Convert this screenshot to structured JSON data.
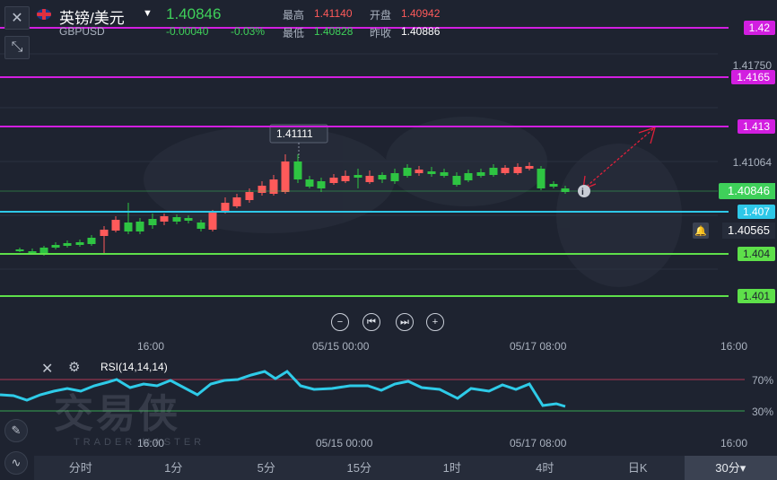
{
  "header": {
    "symbol": "英镑/美元",
    "code": "GBPUSD",
    "last_price": "1.40846",
    "change": "-0.00040",
    "change_pct": "-0.03%",
    "high_label": "最高",
    "high_value": "1.41140",
    "open_label": "开盘",
    "open_value": "1.40942",
    "low_label": "最低",
    "low_value": "1.40828",
    "prev_close_label": "昨收",
    "prev_close_value": "1.40886"
  },
  "levels": [
    {
      "label": "1.42",
      "color": "#d21ee0"
    },
    {
      "label": "1.4165",
      "color": "#d21ee0"
    },
    {
      "label": "1.413",
      "color": "#d21ee0"
    },
    {
      "label": "1.407",
      "color": "#2ec8e8"
    },
    {
      "label": "1.404",
      "color": "#5ee04a"
    },
    {
      "label": "1.401",
      "color": "#5ee04a"
    }
  ],
  "axis_prices": {
    "p1": "1.41750",
    "p2": "1.41064",
    "current": "1.40846",
    "alert": "1.40565"
  },
  "peak_label": "1.41111",
  "price_time_labels": [
    "16:00",
    "05/15 00:00",
    "05/17 08:00",
    "16:00"
  ],
  "rsi": {
    "label": "RSI(14,14,14)",
    "upper": "70%",
    "lower": "30%"
  },
  "rsi_time_labels": [
    "16:00",
    "05/15 00:00",
    "05/17 08:00",
    "16:00"
  ],
  "watermark": {
    "main": "交易侠",
    "sub": "TRADER MASTER"
  },
  "tabs": [
    "分时",
    "1分",
    "5分",
    "15分",
    "1时",
    "4时",
    "日K",
    "30分▾"
  ],
  "colors": {
    "up": "#ff5a5a",
    "down": "#2ec442",
    "bg": "#1e2330"
  }
}
